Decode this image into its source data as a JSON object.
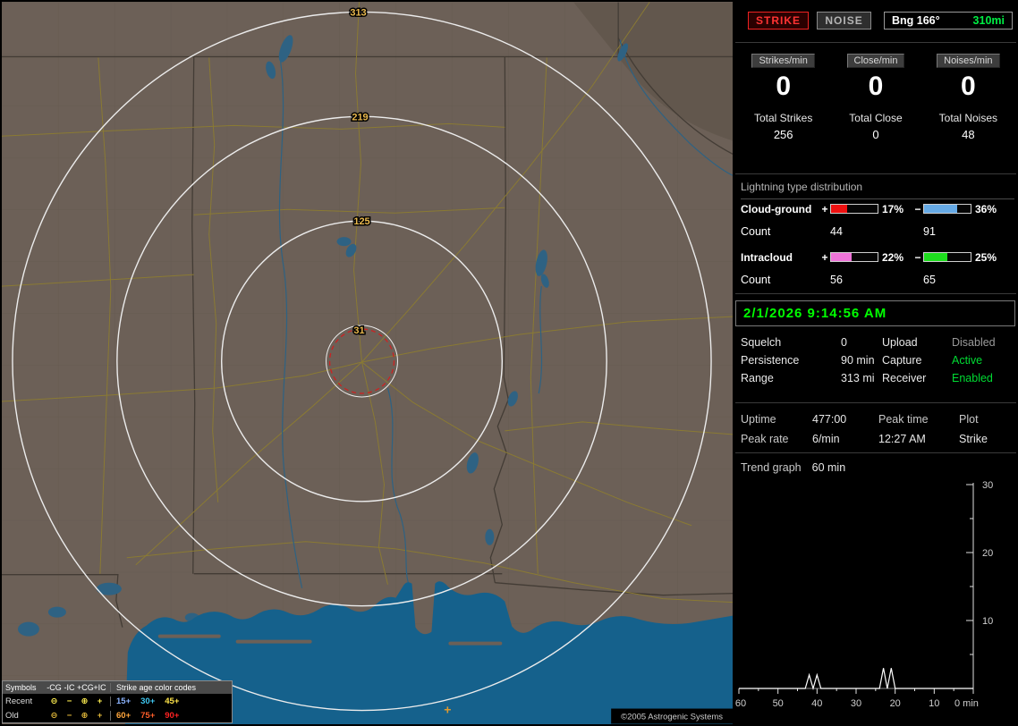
{
  "header": {
    "strike": "STRIKE",
    "noise": "NOISE",
    "bearing": "Bng 166°",
    "range": "310mi"
  },
  "stats": {
    "columns": [
      {
        "rate_label": "Strikes/min",
        "rate": "0",
        "total_label": "Total Strikes",
        "total": "256"
      },
      {
        "rate_label": "Close/min",
        "rate": "0",
        "total_label": "Total Close",
        "total": "0"
      },
      {
        "rate_label": "Noises/min",
        "rate": "0",
        "total_label": "Total Noises",
        "total": "48"
      }
    ]
  },
  "distribution": {
    "title": "Lightning type distribution",
    "count_label": "Count",
    "plus_sign": "+",
    "minus_sign": "−",
    "rows": [
      {
        "label": "Cloud-ground",
        "plus_pct": 17,
        "plus_pct_label": "17%",
        "plus_count": "44",
        "plus_color": "#ee1111",
        "minus_pct": 36,
        "minus_pct_label": "36%",
        "minus_count": "91",
        "minus_color": "#66aae6"
      },
      {
        "label": "Intracloud",
        "plus_pct": 22,
        "plus_pct_label": "22%",
        "plus_count": "56",
        "plus_color": "#ee74d8",
        "minus_pct": 25,
        "minus_pct_label": "25%",
        "minus_count": "65",
        "minus_color": "#1edd1e"
      }
    ]
  },
  "clock": "2/1/2026 9:14:56 AM",
  "settings": {
    "rows": [
      {
        "l1": "Squelch",
        "v1": "0",
        "l2": "Upload",
        "v2": "Disabled"
      },
      {
        "l1": "Persistence",
        "v1": "90 min",
        "l2": "Capture",
        "v2": "Active"
      },
      {
        "l1": "Range",
        "v1": "313 mi",
        "l2": "Receiver",
        "v2": "Enabled"
      }
    ]
  },
  "info": {
    "uptime_label": "Uptime",
    "uptime": "477:00",
    "peak_time_label": "Peak time",
    "plot_label": "Plot",
    "peak_rate_label": "Peak rate",
    "peak_rate": "6/min",
    "peak_time": "12:27 AM",
    "plot_mode": "Strike"
  },
  "trend": {
    "label": "Trend graph",
    "window": "60 min"
  },
  "chart_data": {
    "type": "line",
    "title": "Strike rate trend, last 60 minutes",
    "series_name": "Strikes/min",
    "x_minutes_ago": [
      60,
      59,
      58,
      57,
      56,
      55,
      54,
      53,
      52,
      51,
      50,
      49,
      48,
      47,
      46,
      45,
      44,
      43,
      42,
      41,
      40,
      39,
      38,
      37,
      36,
      35,
      34,
      33,
      32,
      31,
      30,
      29,
      28,
      27,
      26,
      25,
      24,
      23,
      22,
      21,
      20,
      19,
      18,
      17,
      16,
      15,
      14,
      13,
      12,
      11,
      10,
      9,
      8,
      7,
      6,
      5,
      4,
      3,
      2,
      1,
      0
    ],
    "values": [
      0,
      0,
      0,
      0,
      0,
      0,
      0,
      0,
      0,
      0,
      0,
      0,
      0,
      0,
      0,
      0,
      0,
      0,
      2,
      0,
      2,
      0,
      0,
      0,
      0,
      0,
      0,
      0,
      0,
      0,
      0,
      0,
      0,
      0,
      0,
      0,
      0,
      3,
      0,
      3,
      0,
      0,
      0,
      0,
      0,
      0,
      0,
      0,
      0,
      0,
      0,
      0,
      0,
      0,
      0,
      0,
      0,
      0,
      0,
      0,
      0
    ],
    "x_tick_labels": [
      "60",
      "50",
      "40",
      "30",
      "20",
      "10",
      "0 min"
    ],
    "y_tick_labels": [
      "30",
      "20",
      "10"
    ],
    "ylim": [
      0,
      30
    ],
    "xlim": [
      60,
      0
    ],
    "grid": false,
    "legend_position": "none"
  },
  "map": {
    "ring_labels": [
      "313",
      "219",
      "125",
      "31"
    ],
    "strike_marker": "+",
    "copyright": "©2005 Astrogenic Systems",
    "legend": {
      "symbols_header": "Symbols",
      "col_headers": [
        "-CG",
        "-IC",
        "+CG",
        "+IC"
      ],
      "age_header": "Strike age color codes",
      "recent_label": "Recent",
      "old_label": "Old",
      "recent_symbols": [
        "⊖",
        "−",
        "⊕",
        "+"
      ],
      "old_symbols": [
        "⊖",
        "−",
        "⊕",
        "+"
      ],
      "recent_ages": [
        {
          "text": "15+",
          "color": "#8cb4ff"
        },
        {
          "text": "30+",
          "color": "#3fc6f0"
        },
        {
          "text": "45+",
          "color": "#ffe54a"
        }
      ],
      "old_ages": [
        {
          "text": "60+",
          "color": "#ffa53c"
        },
        {
          "text": "75+",
          "color": "#ff5e2a"
        },
        {
          "text": "90+",
          "color": "#ff2222"
        }
      ]
    }
  }
}
